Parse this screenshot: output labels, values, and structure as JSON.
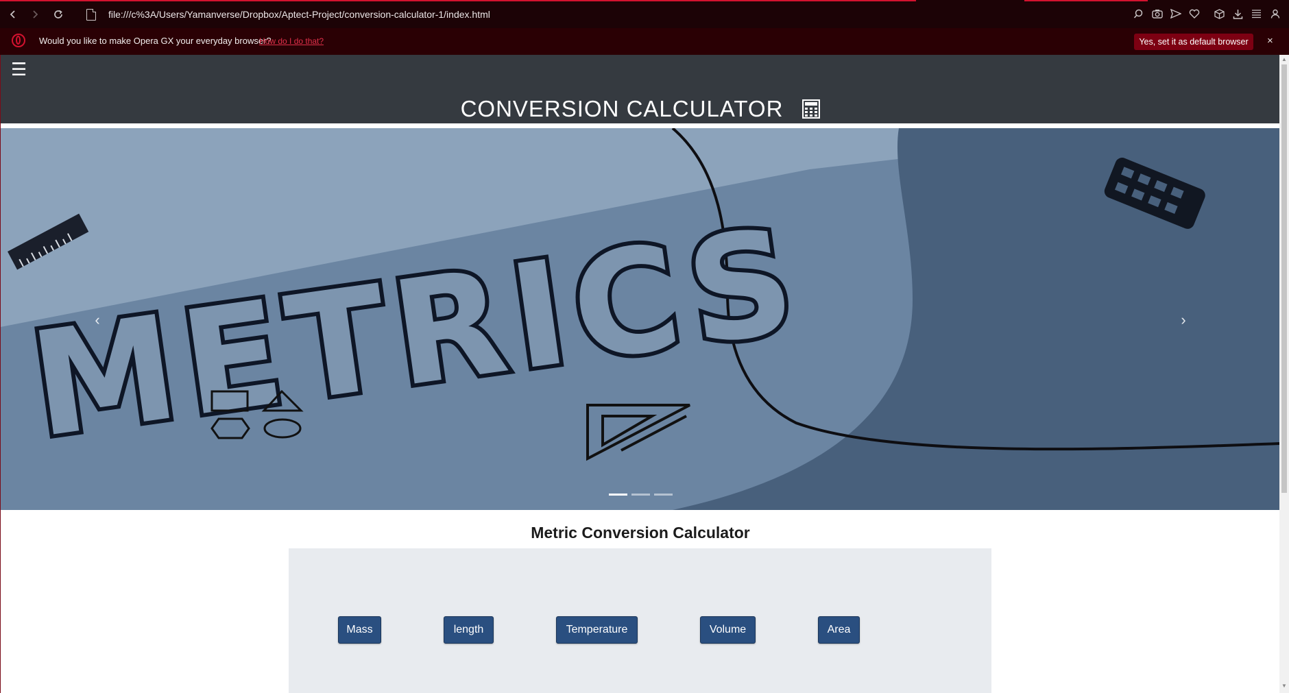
{
  "browser": {
    "url": "file:///c%3A/Users/Yamanverse/Dropbox/Aptect-Project/conversion-calculator-1/index.html",
    "infobar": {
      "message": "Would you like to make Opera GX your everyday browser?",
      "link": "How do I do that?",
      "button": "Yes, set it as default browser",
      "close": "×"
    },
    "toolbar_icons": [
      "search-icon",
      "camera-icon",
      "send-icon",
      "heart-icon",
      "box-icon",
      "download-icon",
      "menu-icon",
      "profile-icon"
    ]
  },
  "site": {
    "menu_icon": "☰",
    "title": "CONVERSION CALCULATOR",
    "carousel": {
      "banner_text": "METRICS",
      "prev": "‹",
      "next": "›",
      "slides": 3,
      "active_slide": 1
    },
    "section_title": "Metric Conversion Calculator",
    "buttons": {
      "mass": "Mass",
      "length": "length",
      "temperature": "Temperature",
      "volume": "Volume",
      "area": "Area"
    }
  },
  "colors": {
    "header": "#353a40",
    "button": "#2a4f80",
    "panel": "#e8ebef",
    "accent": "#d4122f"
  }
}
